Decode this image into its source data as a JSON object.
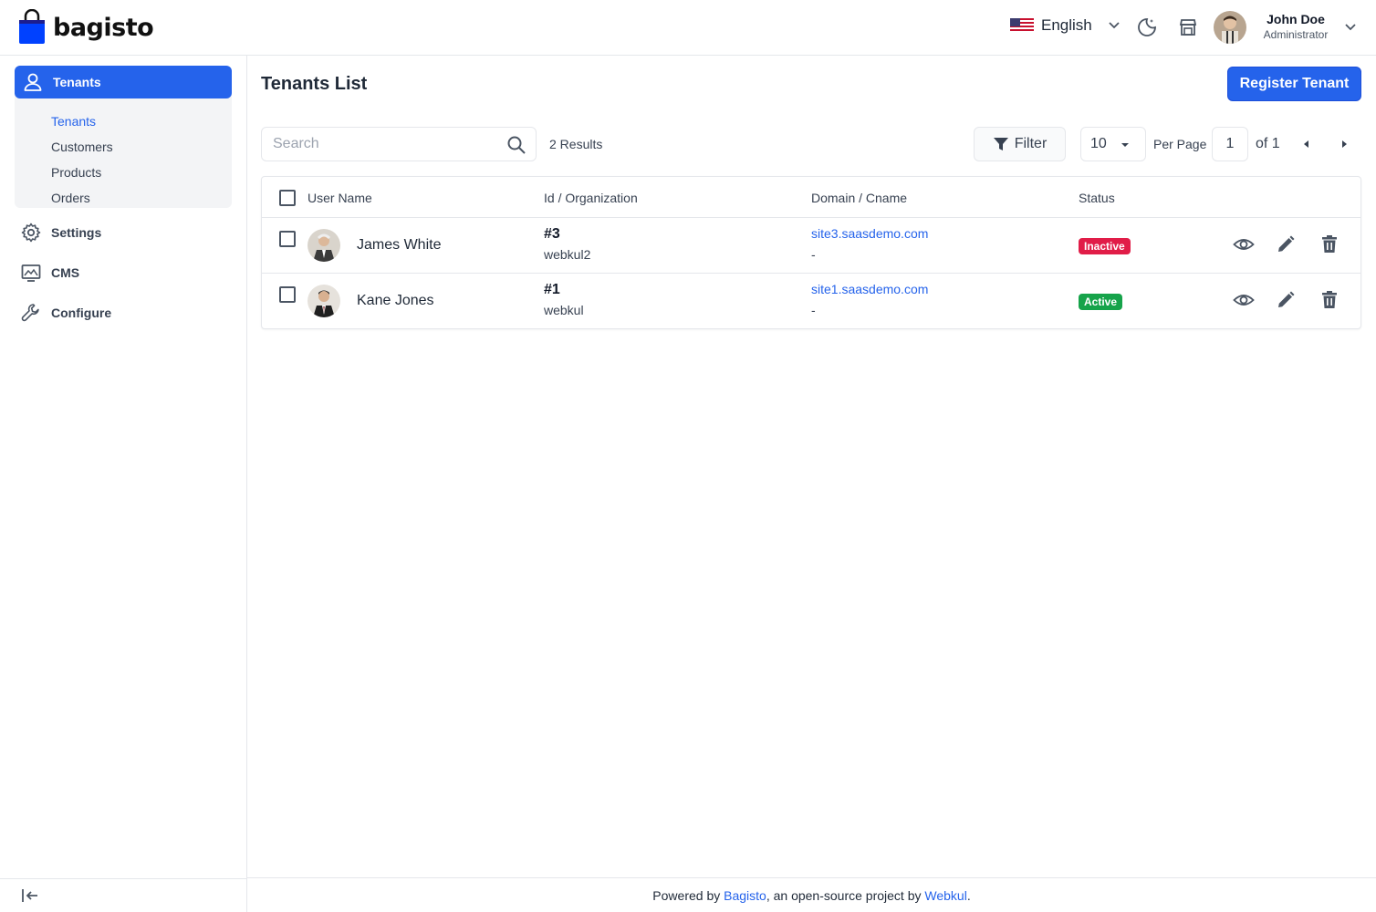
{
  "brand": {
    "name": "bagisto",
    "color": "#0041ff"
  },
  "header": {
    "language": "English",
    "user": {
      "name": "John Doe",
      "role": "Administrator"
    }
  },
  "sidebar": {
    "active_group": "Tenants",
    "sub_items": [
      {
        "label": "Tenants",
        "active": true
      },
      {
        "label": "Customers",
        "active": false
      },
      {
        "label": "Products",
        "active": false
      },
      {
        "label": "Orders",
        "active": false
      }
    ],
    "items": [
      {
        "label": "Settings",
        "icon": "gear-icon"
      },
      {
        "label": "CMS",
        "icon": "monitor-icon"
      },
      {
        "label": "Configure",
        "icon": "wrench-icon"
      }
    ]
  },
  "main": {
    "title": "Tenants List",
    "register_button": "Register Tenant",
    "search_placeholder": "Search",
    "results": "2 Results",
    "filter_label": "Filter",
    "per_page_value": "10",
    "per_page_label": "Per Page",
    "current_page": "1",
    "total_pages_label": "of 1"
  },
  "table": {
    "columns": [
      "User Name",
      "Id / Organization",
      "Domain / Cname",
      "Status"
    ],
    "rows": [
      {
        "name": "James White",
        "id": "#3",
        "organization": "webkul2",
        "domain": "site3.saasdemo.com",
        "cname": "-",
        "status": "Inactive",
        "status_color": "#e11d48"
      },
      {
        "name": "Kane Jones",
        "id": "#1",
        "organization": "webkul",
        "domain": "site1.saasdemo.com",
        "cname": "-",
        "status": "Active",
        "status_color": "#16a34a"
      }
    ]
  },
  "footer": {
    "prefix": "Powered by ",
    "link1": "Bagisto",
    "middle": ", an open-source project by ",
    "link2": "Webkul",
    "suffix": "."
  },
  "colors": {
    "primary": "#2563eb",
    "inactive": "#e11d48",
    "active": "#16a34a"
  }
}
